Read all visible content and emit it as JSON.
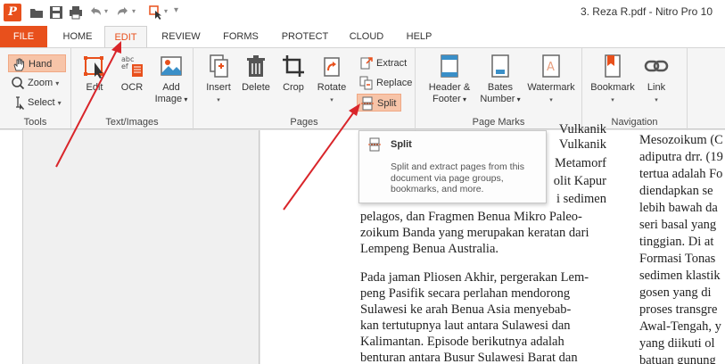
{
  "window": {
    "title": "3. Reza R.pdf - Nitro Pro 10",
    "logo_letter": "P"
  },
  "tabs": {
    "file": "FILE",
    "items": [
      "HOME",
      "EDIT",
      "REVIEW",
      "FORMS",
      "PROTECT",
      "CLOUD",
      "HELP"
    ]
  },
  "ribbon": {
    "tools": {
      "label": "Tools",
      "hand": "Hand",
      "zoom": "Zoom",
      "select": "Select"
    },
    "text_images": {
      "label": "Text/Images",
      "edit": "Edit",
      "ocr": "OCR",
      "add_image_1": "Add",
      "add_image_2": "Image"
    },
    "pages": {
      "label": "Pages",
      "insert": "Insert",
      "delete": "Delete",
      "crop": "Crop",
      "rotate": "Rotate",
      "extract": "Extract",
      "replace": "Replace",
      "split": "Split"
    },
    "page_marks": {
      "label": "Page Marks",
      "header_1": "Header &",
      "header_2": "Footer",
      "bates_1": "Bates",
      "bates_2": "Number",
      "watermark": "Watermark"
    },
    "navigation": {
      "label": "Navigation",
      "bookmark": "Bookmark",
      "link": "Link"
    }
  },
  "tooltip": {
    "title": "Split",
    "desc": "Split and extract pages from this document via page groups, bookmarks, and more."
  },
  "document": {
    "col1_fragments": [
      "Vulkanik",
      "Vulkanik",
      "Metamorf",
      "olit Kapur",
      "i sedimen"
    ],
    "col1_para1": [
      "pelagos, dan Fragmen Benua Mikro Paleo-",
      "zoikum Banda yang merupakan keratan dari",
      "Lempeng Benua Australia."
    ],
    "col1_para2": [
      "Pada jaman Pliosen Akhir, pergerakan Lem-",
      "peng Pasifik secara perlahan mendorong",
      "Sulawesi ke arah Benua Asia menyebab-",
      "kan tertutupnya laut antara Sulawesi dan",
      "Kalimantan. Episode berikutnya adalah",
      "benturan antara Busur Sulawesi Barat dan"
    ],
    "col2": [
      "Mesozoikum (C",
      "adiputra drr. (19",
      "tertua adalah Fo",
      "diendapkan se",
      "lebih bawah da",
      "seri basal yang",
      "tinggian. Di at",
      "Formasi Tonas",
      "sedimen klastik",
      "gosen yang di",
      "proses transgre",
      "Awal-Tengah, y",
      "yang diikuti ol",
      "batuan gunung"
    ]
  },
  "colors": {
    "accent": "#e8501c",
    "annotation": "#d9252a"
  }
}
